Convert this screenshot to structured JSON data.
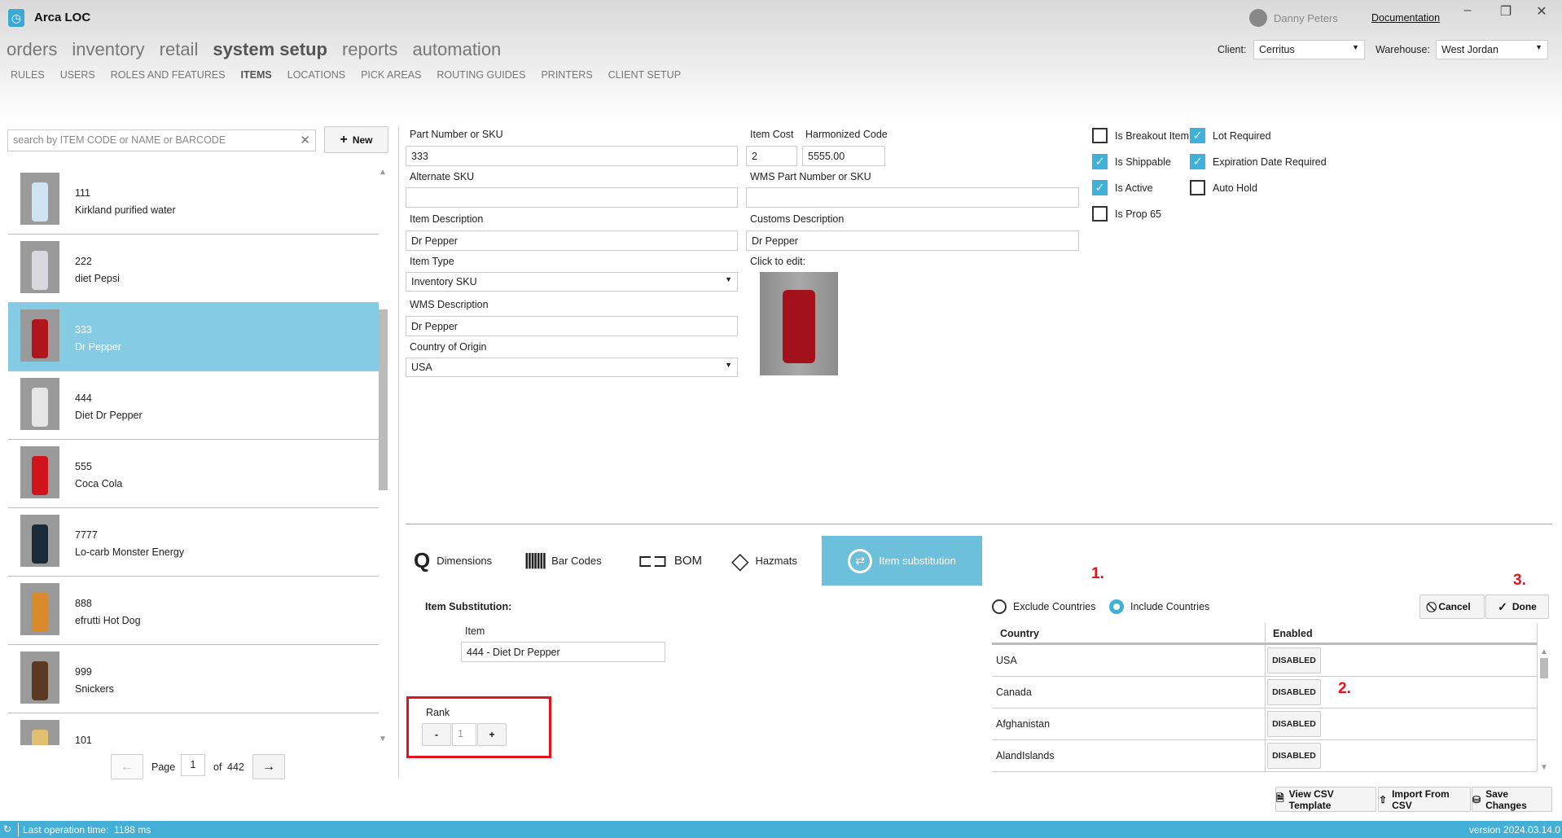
{
  "app": {
    "title": "Arca LOC",
    "user": "Danny Peters",
    "documentation": "Documentation"
  },
  "main_nav": [
    {
      "label": "orders"
    },
    {
      "label": "inventory"
    },
    {
      "label": "retail"
    },
    {
      "label": "system setup",
      "active": true
    },
    {
      "label": "reports"
    },
    {
      "label": "automation"
    }
  ],
  "sub_nav": [
    {
      "label": "RULES"
    },
    {
      "label": "USERS"
    },
    {
      "label": "ROLES AND FEATURES"
    },
    {
      "label": "ITEMS",
      "active": true
    },
    {
      "label": "LOCATIONS"
    },
    {
      "label": "PICK AREAS"
    },
    {
      "label": "ROUTING GUIDES"
    },
    {
      "label": "PRINTERS"
    },
    {
      "label": "CLIENT SETUP"
    }
  ],
  "client": {
    "label": "Client:",
    "value": "Cerritus"
  },
  "warehouse": {
    "label": "Warehouse:",
    "value": "West Jordan"
  },
  "search": {
    "placeholder": "search by ITEM CODE or NAME or BARCODE",
    "new_label": "New"
  },
  "items": [
    {
      "code": "111",
      "name": "Kirkland purified water",
      "color": "#cfe3f2"
    },
    {
      "code": "222",
      "name": "diet Pepsi",
      "color": "#d8d8de"
    },
    {
      "code": "333",
      "name": "Dr Pepper",
      "color": "#b0151c",
      "selected": true
    },
    {
      "code": "444",
      "name": "Diet Dr Pepper",
      "color": "#e6e6e6"
    },
    {
      "code": "555",
      "name": "Coca Cola",
      "color": "#d0141b"
    },
    {
      "code": "7777",
      "name": "Lo-carb Monster Energy",
      "color": "#1a2a36"
    },
    {
      "code": "888",
      "name": "efrutti Hot Dog",
      "color": "#d98a2a"
    },
    {
      "code": "999",
      "name": "Snickers",
      "color": "#5a3a22"
    },
    {
      "code": "101",
      "name": "",
      "color": "#e0c070"
    }
  ],
  "pagination": {
    "page_label": "Page",
    "page": "1",
    "of_label": "of",
    "total": "442"
  },
  "form": {
    "part_number": {
      "label": "Part Number or SKU",
      "value": "333"
    },
    "item_cost": {
      "label": "Item Cost",
      "value": "2"
    },
    "harmonized": {
      "label": "Harmonized Code",
      "value": "5555.00"
    },
    "alternate_sku": {
      "label": "Alternate SKU",
      "value": ""
    },
    "wms_part": {
      "label": "WMS Part Number or SKU",
      "value": ""
    },
    "item_description": {
      "label": "Item Description",
      "value": "Dr Pepper"
    },
    "customs_description": {
      "label": "Customs Description",
      "value": "Dr Pepper"
    },
    "item_type": {
      "label": "Item Type",
      "value": "Inventory SKU"
    },
    "click_to_edit": "Click to edit:",
    "wms_description": {
      "label": "WMS Description",
      "value": "Dr Pepper"
    },
    "country_of_origin": {
      "label": "Country of Origin",
      "value": "USA"
    }
  },
  "checkboxes": [
    {
      "label": "Is Breakout Item",
      "checked": false
    },
    {
      "label": "Lot Required",
      "checked": true
    },
    {
      "label": "Is Shippable",
      "checked": true
    },
    {
      "label": "Expiration Date Required",
      "checked": true
    },
    {
      "label": "Is Active",
      "checked": true
    },
    {
      "label": "Auto Hold",
      "checked": false
    },
    {
      "label": "Is Prop 65",
      "checked": false
    }
  ],
  "tabs": [
    {
      "label": "Dimensions",
      "icon": "tape-measure-icon"
    },
    {
      "label": "Bar Codes",
      "icon": "barcode-icon"
    },
    {
      "label": "BOM",
      "icon": "hierarchy-icon"
    },
    {
      "label": "Hazmats",
      "icon": "diamond-icon"
    },
    {
      "label": "Item substitution",
      "icon": "swap-icon",
      "active": true
    }
  ],
  "substitution": {
    "title": "Item Substitution:",
    "item_label": "Item",
    "item_value": "444 - Diet Dr Pepper",
    "rank_label": "Rank",
    "rank_value": "1",
    "minus": "-",
    "plus": "+"
  },
  "annotations": {
    "one": "1.",
    "two": "2.",
    "three": "3."
  },
  "countries": {
    "exclude_label": "Exclude Countries",
    "include_label": "Include Countries",
    "selected": "Include Countries",
    "headers": {
      "country": "Country",
      "enabled": "Enabled"
    },
    "rows": [
      {
        "country": "USA",
        "state": "DISABLED"
      },
      {
        "country": "Canada",
        "state": "DISABLED"
      },
      {
        "country": "Afghanistan",
        "state": "DISABLED"
      },
      {
        "country": "AlandIslands",
        "state": "DISABLED"
      }
    ]
  },
  "actions": {
    "cancel": "Cancel",
    "done": "Done",
    "view_csv": "View CSV Template",
    "import_csv": "Import From CSV",
    "save": "Save Changes"
  },
  "status": {
    "last_op": "Last operation time:  1188 ms",
    "version": "version 2024.03.14.0"
  },
  "colors": {
    "accent": "#43afd6",
    "selected_row": "#86cbe4",
    "annotation": "#e3141e"
  }
}
